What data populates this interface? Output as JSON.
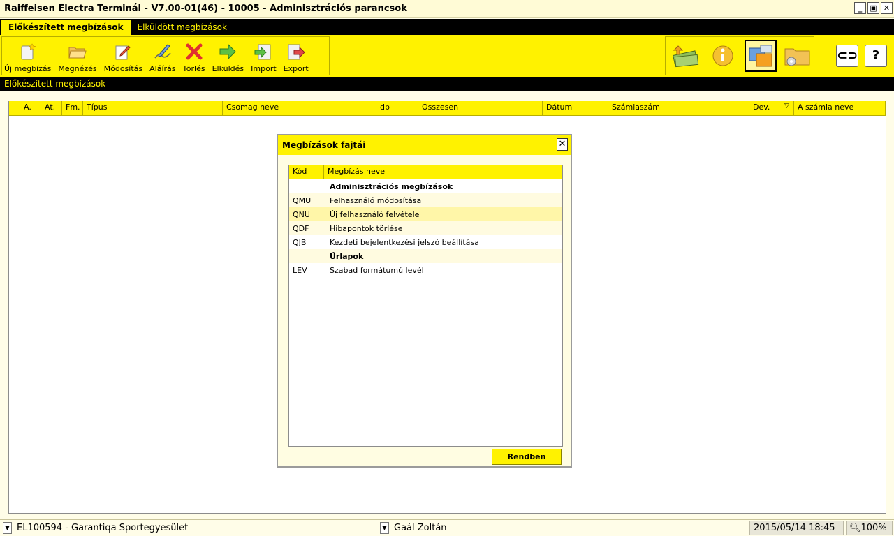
{
  "window": {
    "title": "Raiffeisen Electra Terminál - V7.00-01(46) - 10005 - Adminisztrációs parancsok",
    "controls": [
      "_",
      "▣",
      "✕"
    ]
  },
  "tabs": [
    {
      "label": "Előkészített megbízások",
      "active": true
    },
    {
      "label": "Elküldött megbízások",
      "active": false
    }
  ],
  "toolbar": {
    "new_label": "Új megbízás",
    "view_label": "Megnézés",
    "edit_label": "Módosítás",
    "sign_label": "Aláírás",
    "delete_label": "Törlés",
    "send_label": "Elküldés",
    "import_label": "Import",
    "export_label": "Export",
    "swap_label": "⊂⊃",
    "help_label": "?"
  },
  "section_title": "Előkészített megbízások",
  "grid": {
    "columns": [
      "A.",
      "At.",
      "Fm.",
      "Típus",
      "Csomag neve",
      "db",
      "Összesen",
      "Dátum",
      "Számlaszám",
      "Dev.",
      "A számla neve"
    ]
  },
  "dialog": {
    "title": "Megbízások fajtái",
    "close": "✕",
    "col_code": "Kód",
    "col_name": "Megbízás neve",
    "rows": [
      {
        "code": "",
        "name": "Adminisztrációs megbízások"
      },
      {
        "code": "QMU",
        "name": "Felhasználó módosítása"
      },
      {
        "code": "QNU",
        "name": "Új felhasználó felvétele"
      },
      {
        "code": "QDF",
        "name": "Hibapontok törlése"
      },
      {
        "code": "QJB",
        "name": "Kezdeti bejelentkezési jelszó beállítása"
      },
      {
        "code": "",
        "name": "Űrlapok"
      },
      {
        "code": "LEV",
        "name": "Szabad formátumú levél"
      }
    ],
    "ok_label": "Rendben"
  },
  "statusbar": {
    "account": "EL100594 - Garantiqa Sportegyesület",
    "user": "Gaál Zoltán",
    "datetime": "2015/05/14 18:45",
    "zoom": "100%"
  },
  "colors": {
    "accent": "#fff200",
    "dark": "#000000",
    "background": "#fffde8"
  }
}
